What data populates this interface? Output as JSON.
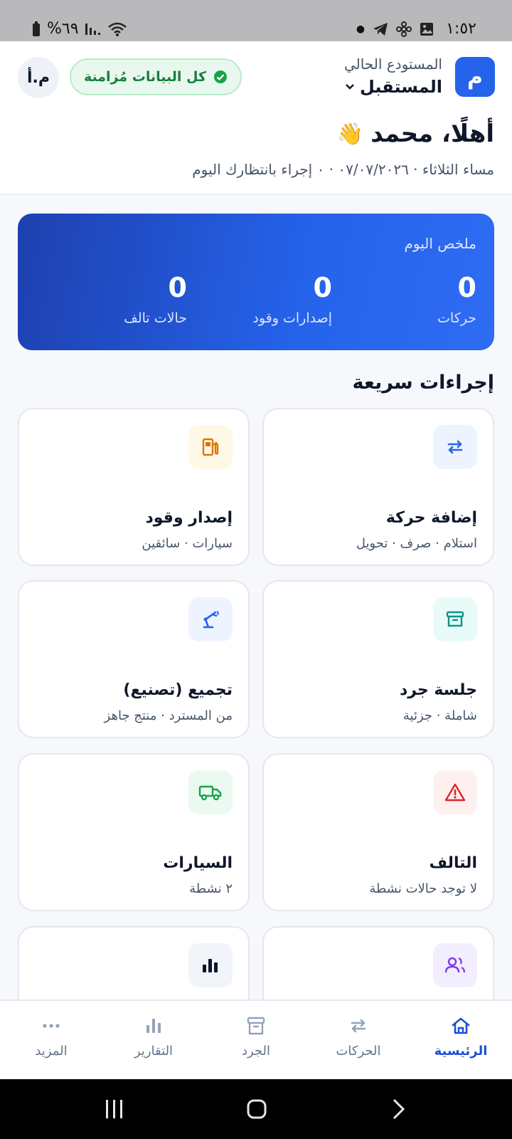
{
  "status_bar": {
    "time": "١:٥٢",
    "battery": "%٦٩"
  },
  "header": {
    "logo_letter": "م",
    "warehouse_label": "المستودع الحالي",
    "warehouse_value": "المستقبل",
    "sync_status": "كل البيانات مُزامنة",
    "avatar_initials": "م.أ",
    "greeting": "أهلًا، محمد",
    "greeting_emoji": "👋",
    "subline": "مساء الثلاثاء · ٠٧/٠٧/٢٠٢٦ · ٠ إجراء بانتظارك اليوم"
  },
  "summary": {
    "title": "ملخص اليوم",
    "stats": [
      {
        "value": "0",
        "label": "حركات"
      },
      {
        "value": "0",
        "label": "إصدارات وقود"
      },
      {
        "value": "0",
        "label": "حالات تالف"
      }
    ]
  },
  "quick_actions": {
    "title": "إجراءات سريعة",
    "cards": [
      {
        "title": "إضافة حركة",
        "subtitle": "استلام · صرف · تحويل",
        "icon": "transfer-arrows-icon",
        "color": "#2563eb"
      },
      {
        "title": "إصدار وقود",
        "subtitle": "سيارات · سائقين",
        "icon": "fuel-pump-icon",
        "color": "#d97706"
      },
      {
        "title": "جلسة جرد",
        "subtitle": "شاملة · جزئية",
        "icon": "archive-box-icon",
        "color": "#0d9488"
      },
      {
        "title": "تجميع (تصنيع)",
        "subtitle": "من المسترد · منتج جاهز",
        "icon": "robot-arm-icon",
        "color": "#2563eb"
      },
      {
        "title": "التالف",
        "subtitle": "لا توجد حالات نشطة",
        "icon": "warning-triangle-icon",
        "color": "#dc2626"
      },
      {
        "title": "السيارات",
        "subtitle": "٢ نشطة",
        "icon": "truck-icon",
        "color": "#16a34a"
      },
      {
        "title": "",
        "subtitle": "",
        "icon": "users-icon",
        "color": "#7c3aed"
      },
      {
        "title": "",
        "subtitle": "",
        "icon": "bar-chart-icon",
        "color": "#0f172a"
      }
    ]
  },
  "bottom_nav": {
    "items": [
      {
        "label": "الرئيسية",
        "icon": "home-icon",
        "active": true
      },
      {
        "label": "الحركات",
        "icon": "transfer-arrows-icon",
        "active": false
      },
      {
        "label": "الجرد",
        "icon": "archive-box-icon",
        "active": false
      },
      {
        "label": "التقارير",
        "icon": "bar-chart-icon",
        "active": false
      },
      {
        "label": "المزيد",
        "icon": "more-dots-icon",
        "active": false
      }
    ]
  }
}
